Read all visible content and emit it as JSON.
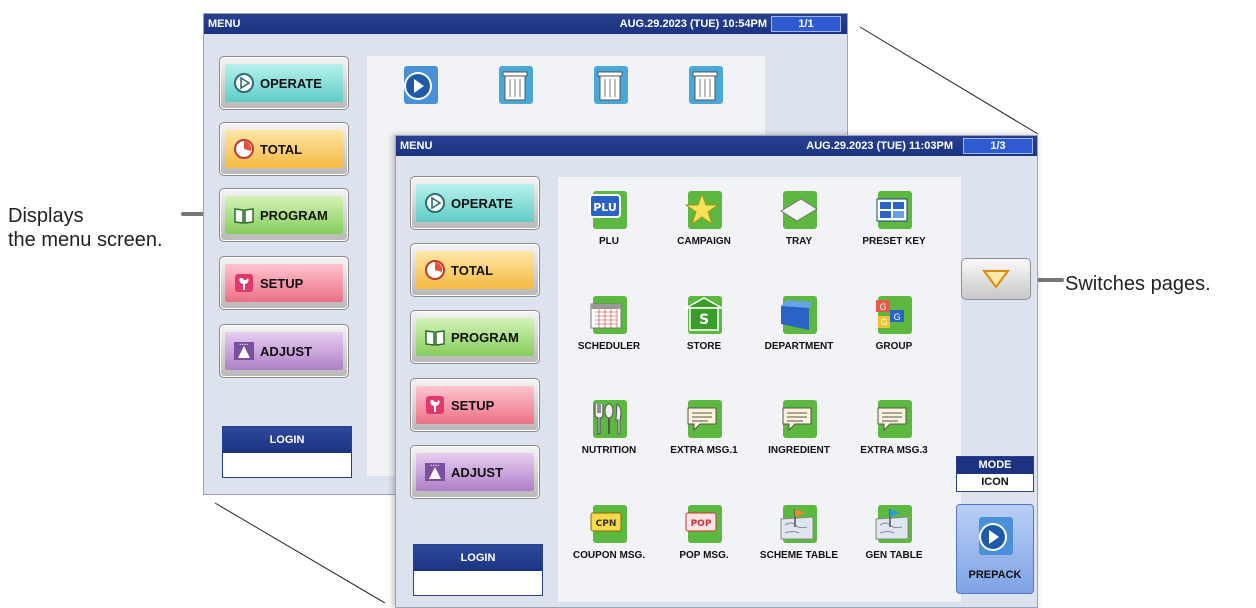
{
  "back_screen": {
    "title": "MENU",
    "datetime": "AUG.29.2023 (TUE)  10:54PM",
    "page": "1/1",
    "sidebar": [
      {
        "label": "OPERATE",
        "icon": "play-circle-icon"
      },
      {
        "label": "TOTAL",
        "icon": "pie-clock-icon"
      },
      {
        "label": "PROGRAM",
        "icon": "open-book-icon"
      },
      {
        "label": "SETUP",
        "icon": "wrench-icon"
      },
      {
        "label": "ADJUST",
        "icon": "scale-icon"
      }
    ],
    "login_label": "LOGIN",
    "tiles": [
      {
        "icon": "play-icon"
      },
      {
        "icon": "trash-icon"
      },
      {
        "icon": "trash-icon"
      },
      {
        "icon": "trash-icon"
      }
    ]
  },
  "front_screen": {
    "title": "MENU",
    "datetime": "AUG.29.2023 (TUE)  11:03PM",
    "page": "1/3",
    "sidebar": [
      {
        "label": "OPERATE",
        "icon": "play-circle-icon"
      },
      {
        "label": "TOTAL",
        "icon": "pie-clock-icon"
      },
      {
        "label": "PROGRAM",
        "icon": "open-book-icon"
      },
      {
        "label": "SETUP",
        "icon": "wrench-icon"
      },
      {
        "label": "ADJUST",
        "icon": "scale-icon"
      }
    ],
    "login_label": "LOGIN",
    "tiles": [
      {
        "label": "PLU",
        "icon": "plu-icon"
      },
      {
        "label": "CAMPAIGN",
        "icon": "star-icon"
      },
      {
        "label": "TRAY",
        "icon": "tray-icon"
      },
      {
        "label": "PRESET KEY",
        "icon": "preset-key-icon"
      },
      {
        "label": "SCHEDULER",
        "icon": "calendar-icon"
      },
      {
        "label": "STORE",
        "icon": "store-icon"
      },
      {
        "label": "DEPARTMENT",
        "icon": "folder-icon"
      },
      {
        "label": "GROUP",
        "icon": "group-icon"
      },
      {
        "label": "NUTRITION",
        "icon": "cutlery-icon"
      },
      {
        "label": "EXTRA MSG.1",
        "icon": "message-icon"
      },
      {
        "label": "INGREDIENT",
        "icon": "message-icon"
      },
      {
        "label": "EXTRA MSG.3",
        "icon": "message-icon"
      },
      {
        "label": "COUPON MSG.",
        "icon": "coupon-icon"
      },
      {
        "label": "POP MSG.",
        "icon": "pop-icon"
      },
      {
        "label": "SCHEME TABLE",
        "icon": "map-flag-icon"
      },
      {
        "label": "GEN TABLE",
        "icon": "map-flag-icon"
      }
    ],
    "scroll_icon": "triangle-down-icon",
    "mode": {
      "label": "MODE",
      "value": "ICON"
    },
    "prepack": {
      "label": "PREPACK",
      "icon": "play-icon"
    }
  },
  "callouts": {
    "left": "Displays\nthe menu screen.",
    "right": "Switches pages."
  },
  "colors": {
    "titlebar": "#1d3382",
    "operate": "#5fcdc5",
    "total": "#f5b941",
    "program": "#86cd5c",
    "setup": "#ec7086",
    "adjust": "#ad80c7",
    "tile_green": "#6cc04a"
  }
}
